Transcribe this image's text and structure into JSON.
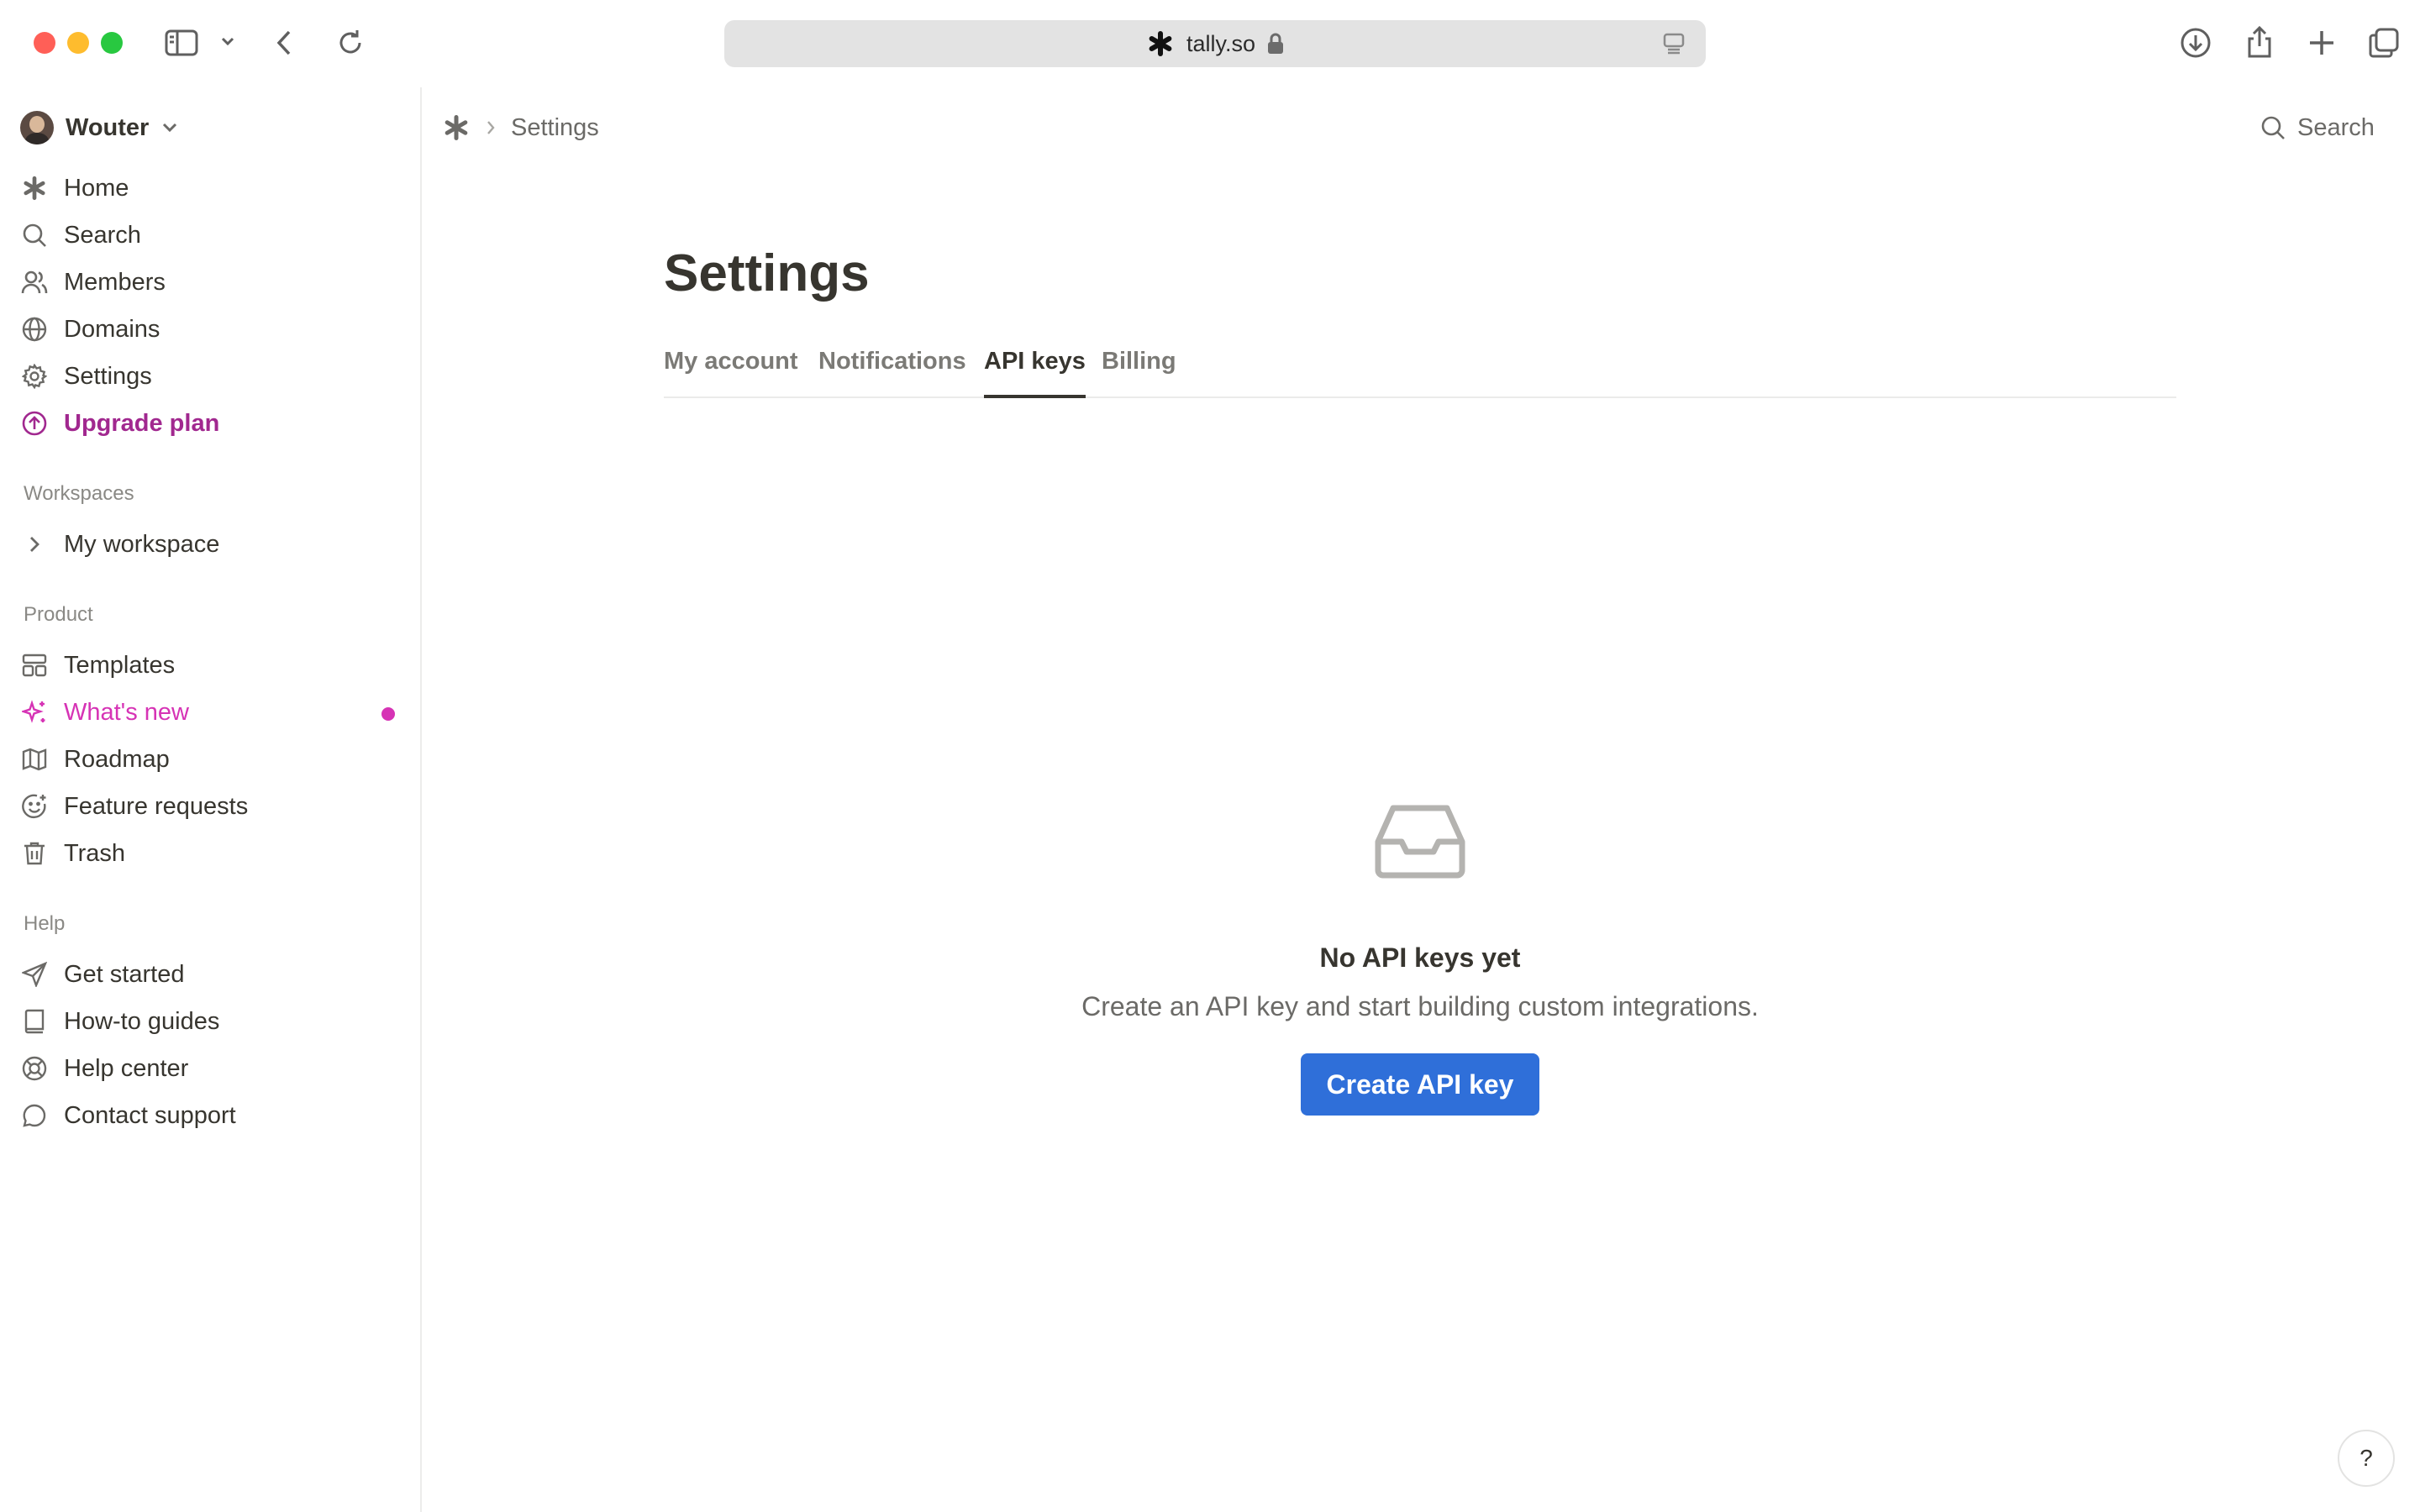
{
  "browser": {
    "url": "tally.so"
  },
  "user": {
    "name": "Wouter"
  },
  "sidebar": {
    "main_items": [
      {
        "label": "Home",
        "icon": "tally-logo-icon"
      },
      {
        "label": "Search",
        "icon": "search-icon"
      },
      {
        "label": "Members",
        "icon": "members-icon"
      },
      {
        "label": "Domains",
        "icon": "globe-icon"
      },
      {
        "label": "Settings",
        "icon": "gear-icon"
      },
      {
        "label": "Upgrade plan",
        "icon": "upgrade-icon"
      }
    ],
    "workspaces": {
      "label": "Workspaces",
      "items": [
        {
          "label": "My workspace"
        }
      ]
    },
    "product": {
      "label": "Product",
      "items": [
        {
          "label": "Templates",
          "icon": "templates-icon"
        },
        {
          "label": "What's new",
          "icon": "sparkle-icon"
        },
        {
          "label": "Roadmap",
          "icon": "map-icon"
        },
        {
          "label": "Feature requests",
          "icon": "smile-icon"
        },
        {
          "label": "Trash",
          "icon": "trash-icon"
        }
      ]
    },
    "help": {
      "label": "Help",
      "items": [
        {
          "label": "Get started",
          "icon": "send-icon"
        },
        {
          "label": "How-to guides",
          "icon": "book-icon"
        },
        {
          "label": "Help center",
          "icon": "lifebuoy-icon"
        },
        {
          "label": "Contact support",
          "icon": "chat-icon"
        }
      ]
    }
  },
  "breadcrumb": {
    "current": "Settings"
  },
  "header": {
    "search_label": "Search"
  },
  "page": {
    "title": "Settings",
    "tabs": [
      {
        "label": "My account",
        "active": false
      },
      {
        "label": "Notifications",
        "active": false
      },
      {
        "label": "API keys",
        "active": true
      },
      {
        "label": "Billing",
        "active": false
      }
    ]
  },
  "empty_state": {
    "title": "No API keys yet",
    "description": "Create an API key and start building custom integrations.",
    "button_label": "Create API key"
  },
  "help_button": {
    "label": "?"
  },
  "colors": {
    "accent_purple": "#a1288f",
    "whats_new_pink": "#d633b5",
    "primary_button": "#2f6fd9"
  }
}
